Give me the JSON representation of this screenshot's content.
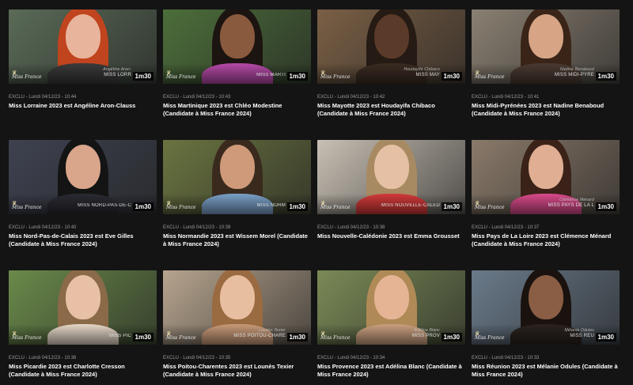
{
  "cards": [
    {
      "meta": "EXCLU - Lundi 04/12/23 - 10:44",
      "title": "Miss Lorraine 2023 est Angéline Aron-Clauss",
      "caption": "MISS LORR",
      "caption_sub": "Angéline Aron-",
      "duration": "1m30",
      "bg": "#5a6b57",
      "hair": "#c0441e",
      "face": "#e8b49b",
      "body": "#3a3a3a"
    },
    {
      "meta": "EXCLU - Lundi 04/12/23 - 10:43",
      "title": "Miss Martinique 2023 est Chléo Modestine (Candidate à Miss France 2024)",
      "caption": "MISS MARTI",
      "caption_sub": "",
      "duration": "1m30",
      "bg": "#4c6e3a",
      "hair": "#1c1410",
      "face": "#8a5a3e",
      "body": "#b64aa8"
    },
    {
      "meta": "EXCLU - Lundi 04/12/23 - 10:42",
      "title": "Miss Mayotte 2023 est Houdayifa Chibaco (Candidate à Miss France 2024)",
      "caption": "MISS MAY",
      "caption_sub": "Houdayifa Chibaco",
      "duration": "1m30",
      "bg": "#7a5f45",
      "hair": "#251a14",
      "face": "#5a3a28",
      "body": "#3a2c22"
    },
    {
      "meta": "EXCLU - Lundi 04/12/23 - 10:41",
      "title": "Miss Midi-Pyrénées 2023 est Nadine Benaboud (Candidate à Miss France 2024)",
      "caption": "MISS MIDI-PYRE",
      "caption_sub": "Nadine Benaboud",
      "duration": "1m30",
      "bg": "#8a8072",
      "hair": "#3a2418",
      "face": "#d7a585",
      "body": "#4a3a32"
    },
    {
      "meta": "EXCLU - Lundi 04/12/23 - 10:40",
      "title": "Miss Nord-Pas-de-Calais 2023 est Eve Gilles (Candidate à Miss France 2024)",
      "caption": "MISS NORD-PAS-DE-C",
      "caption_sub": "",
      "duration": "1m30",
      "bg": "#3e4250",
      "hair": "#141414",
      "face": "#d9a58b",
      "body": "#2a2a32"
    },
    {
      "meta": "EXCLU - Lundi 04/12/23 - 10:39",
      "title": "Miss Normandie 2023 est Wissem Morel (Candidate à Miss France 2024)",
      "caption": "MISS NORM",
      "caption_sub": "",
      "duration": "1m30",
      "bg": "#6a7440",
      "hair": "#3a2a1e",
      "face": "#cf9a7a",
      "body": "#7aa0c8"
    },
    {
      "meta": "EXCLU - Lundi 04/12/23 - 10:38",
      "title": "Miss Nouvelle-Calédonie 2023 est Emma Grousset",
      "caption": "MISS NOUVELLE-CALED",
      "caption_sub": "",
      "duration": "1m30",
      "bg": "#c8c0b4",
      "hair": "#a88a62",
      "face": "#e6c0a4",
      "body": "#d23a3a"
    },
    {
      "meta": "EXCLU - Lundi 04/12/23 - 10:37",
      "title": "Miss Pays de La Loire 2023 est Clémence Ménard (Candidate à Miss France 2024)",
      "caption": "MISS PAYS DE LA L",
      "caption_sub": "Clémence Ménard",
      "duration": "1m30",
      "bg": "#8a7a6a",
      "hair": "#3a2218",
      "face": "#e0ae92",
      "body": "#d84a8a"
    },
    {
      "meta": "EXCLU - Lundi 04/12/23 - 10:36",
      "title": "Miss Picardie 2023 est Charlotte Cresson (Candidate à Miss France 2024)",
      "caption": "MISS PIC",
      "caption_sub": "",
      "duration": "1m30",
      "bg": "#6a8a4a",
      "hair": "#8a6a48",
      "face": "#e8c0a6",
      "body": "#e6d8c8"
    },
    {
      "meta": "EXCLU - Lundi 04/12/23 - 10:35",
      "title": "Miss Poitou-Charentes 2023 est Lounès Texier (Candidate à Miss France 2024)",
      "caption": "MISS POITOU-CHARE",
      "caption_sub": "Lounès Texier",
      "duration": "1m30",
      "bg": "#b6a48e",
      "hair": "#9a6a40",
      "face": "#e8bea0",
      "body": "#c89a78"
    },
    {
      "meta": "EXCLU - Lundi 04/12/23 - 10:34",
      "title": "Miss Provence 2023 est Adélina Blanc (Candidate à Miss France 2024)",
      "caption": "MISS PROV",
      "caption_sub": "Adélina Blanc",
      "duration": "1m30",
      "bg": "#7a8a56",
      "hair": "#b08a56",
      "face": "#e4b494",
      "body": "#caa080"
    },
    {
      "meta": "EXCLU - Lundi 04/12/23 - 10:33",
      "title": "Miss Réunion 2023 est Mélanie Odules (Candidate à Miss France 2024)",
      "caption": "MISS REU",
      "caption_sub": "Mélanie Odules",
      "duration": "1m30",
      "bg": "#6a7a8a",
      "hair": "#1a120e",
      "face": "#8a5e44",
      "body": "#2a221e"
    }
  ],
  "logo": {
    "line1": "Miss",
    "line2": "France"
  }
}
